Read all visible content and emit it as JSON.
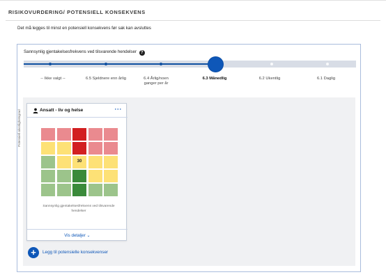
{
  "header": {
    "title": "RISIKOVURDERING/ POTENSIELL KONSEKVENS"
  },
  "instruction": "Det må legges til minst en potensiell konsekvens før sak kan avsluttes",
  "frequency": {
    "label": "Sannsynlig gjentakelsesfrekvens ved tilsvarende hendelser",
    "help_icon": "question-circle-icon",
    "selected_index": 3,
    "options": [
      "-- Ikke valgt --",
      "6.5 Sjeldnere enn årlig",
      "6.4 Årlig/noen ganger per år",
      "6.3 Månedlig",
      "6.2 Ukentlig",
      "6.1 Daglig"
    ],
    "accent": "#0e57b8"
  },
  "card": {
    "icon": "person-icon",
    "title": "Ansatt - liv og helse",
    "menu_icon": "more-horizontal-icon",
    "matrix": {
      "ylabel": "Potensiell alvorlighetsgrad",
      "xlabel": "Sannsynlig gjentakelsesfrekvens ved tilsvarende hendelser",
      "marked_value": "30",
      "colors": {
        "red_light": "#ea8a8f",
        "red_dark": "#d21f21",
        "yellow": "#fde176",
        "green_light": "#9cc48b",
        "green_dark": "#3a8a3a"
      }
    },
    "details_link": "Vis detaljer ⌄"
  },
  "add_consequence": {
    "label": "Legg til potensielle konsekvenser",
    "icon": "plus-icon"
  }
}
